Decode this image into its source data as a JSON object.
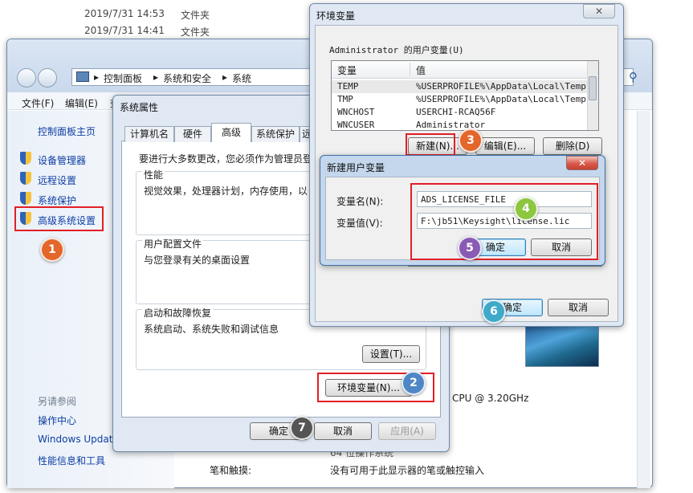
{
  "colors": {
    "accent_red": "#e21f26",
    "badge_orange": "#e3662b",
    "badge_blue": "#4f86c6",
    "badge_green": "#8dc63f",
    "badge_purple": "#8a5bb5",
    "badge_teal": "#3fa9c9",
    "badge_gray": "#555555",
    "link_blue": "#0d3da3"
  },
  "explorer_rows": [
    {
      "date": "2019/7/31 14:53",
      "type": "文件夹"
    },
    {
      "date": "2019/7/31 14:41",
      "type": "文件夹"
    }
  ],
  "control_panel": {
    "breadcrumb": [
      "控制面板",
      "系统和安全",
      "系统"
    ],
    "menu": [
      "文件(F)",
      "编辑(E)",
      "查"
    ],
    "home": "控制面板主页",
    "links": [
      "设备管理器",
      "远程设置",
      "系统保护",
      "高级系统设置"
    ],
    "see_also": "另请参阅",
    "also_links": [
      "操作中心",
      "Windows Update",
      "性能信息和工具"
    ],
    "cpu": "CPU @ 3.20GHz",
    "pen_label": "笔和触摸:",
    "pen_value": "没有可用于此显示器的笔或触控输入",
    "partial_row": "64 位操作系统"
  },
  "system_properties": {
    "title": "系统属性",
    "tabs": [
      "计算机名",
      "硬件",
      "高级",
      "系统保护",
      "远"
    ],
    "admin_note": "要进行大多数更改，您必须作为管理员登",
    "performance": {
      "title": "性能",
      "desc": "视觉效果，处理器计划，内存使用，以"
    },
    "user_profiles": {
      "title": "用户配置文件",
      "desc": "与您登录有关的桌面设置"
    },
    "startup": {
      "title": "启动和故障恢复",
      "desc": "系统启动、系统失败和调试信息"
    },
    "settings_button": "设置(T)...",
    "env_button": "环境变量(N)...",
    "ok": "确定",
    "cancel": "取消",
    "apply": "应用(A)"
  },
  "env_vars": {
    "title": "环境变量",
    "user_section": "Administrator 的用户变量(U)",
    "col_var": "变量",
    "col_val": "值",
    "rows": [
      {
        "name": "TEMP",
        "value": "%USERPROFILE%\\AppData\\Local\\Temp"
      },
      {
        "name": "TMP",
        "value": "%USERPROFILE%\\AppData\\Local\\Temp"
      },
      {
        "name": "WNCHOST",
        "value": "USERCHI-RCAQ56F"
      },
      {
        "name": "WNCUSER",
        "value": "Administrator"
      }
    ],
    "new": "新建(N)...",
    "edit": "编辑(E)...",
    "delete": "删除(D)",
    "ok": "确定",
    "cancel": "取消"
  },
  "new_var": {
    "title": "新建用户变量",
    "name_label": "变量名(N):",
    "name_value": "ADS_LICENSE_FILE",
    "value_label": "变量值(V):",
    "value_value": "F:\\jb51\\Keysight\\license.lic",
    "ok": "确定",
    "cancel": "取消"
  },
  "badges": [
    "1",
    "2",
    "3",
    "4",
    "5",
    "6",
    "7"
  ]
}
